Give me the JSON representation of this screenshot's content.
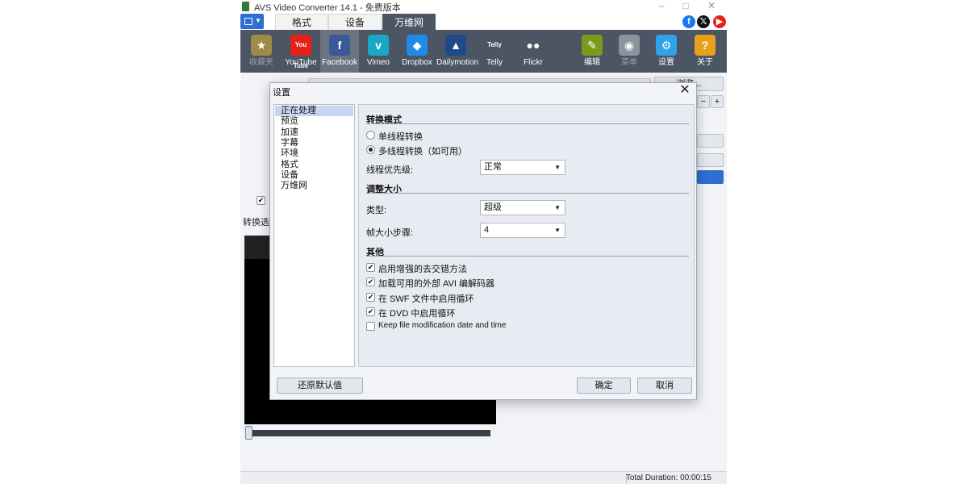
{
  "window": {
    "title": "AVS Video Converter 14.1 - 免费版本",
    "controls": [
      "–",
      "□",
      "✕"
    ]
  },
  "tabs": [
    "格式",
    "设备",
    "万维网"
  ],
  "active_tab": "万维网",
  "social": [
    {
      "icon": "facebook-icon",
      "glyph": "f",
      "color": "#1877f2"
    },
    {
      "icon": "x-icon",
      "glyph": "𝕏",
      "color": "#111111"
    },
    {
      "icon": "youtube-icon",
      "glyph": "▶",
      "color": "#e62117"
    }
  ],
  "toolbar": {
    "items": [
      {
        "label": "收藏夹",
        "icon": "star-icon",
        "glyph": "★",
        "color": "#a08a46",
        "dim": true
      },
      {
        "label": "YouTube",
        "icon": "youtube-icon",
        "glyph": "You Tube",
        "color": "#e62117"
      },
      {
        "label": "Facebook",
        "icon": "facebook-icon",
        "glyph": "f",
        "color": "#3b5998",
        "active": true
      },
      {
        "label": "Vimeo",
        "icon": "vimeo-icon",
        "glyph": "v",
        "color": "#17a8c5"
      },
      {
        "label": "Dropbox",
        "icon": "dropbox-icon",
        "glyph": "◆",
        "color": "#1f8ae8"
      },
      {
        "label": "Dailymotion",
        "icon": "dailymotion-icon",
        "glyph": "▲",
        "color": "#1f4a8a"
      },
      {
        "label": "Telly",
        "icon": "telly-icon",
        "glyph": "Telly",
        "color": "#4b5563"
      },
      {
        "label": "Flickr",
        "icon": "flickr-icon",
        "glyph": "●●",
        "color": "#4b5563"
      },
      {
        "label": "编辑",
        "icon": "pencil-icon",
        "glyph": "✎",
        "color": "#7a9a1d"
      },
      {
        "label": "菜单",
        "icon": "disc-icon",
        "glyph": "◉",
        "color": "#8b939d",
        "dim": true
      },
      {
        "label": "设置",
        "icon": "gear-icon",
        "glyph": "⚙",
        "color": "#2ea3e8"
      },
      {
        "label": "关于",
        "icon": "help-icon",
        "glyph": "?",
        "color": "#e8a11d"
      }
    ]
  },
  "background": {
    "browse_label": "浏览...",
    "checkbox_checked": "✔",
    "conversion_options_label": "转换选",
    "status": {
      "total_duration": "Total Duration: 00:00:15"
    }
  },
  "dialog": {
    "title": "设置",
    "nav": [
      "正在处理",
      "预览",
      "加速",
      "字幕",
      "环境",
      "格式",
      "设备",
      "万维网"
    ],
    "active_nav": "正在处理",
    "conversion_mode": {
      "heading": "转换模式",
      "single_thread": "单线程转换",
      "multi_thread": "多线程转换（如可用）",
      "selected": "multi_thread",
      "priority_label": "线程优先级:",
      "priority_value": "正常"
    },
    "resize": {
      "heading": "调整大小",
      "type_label": "类型:",
      "type_value": "超级",
      "step_label": "帧大小步骤:",
      "step_value": "4"
    },
    "other": {
      "heading": "其他",
      "options": [
        {
          "label": "启用增强的去交错方法",
          "checked": true
        },
        {
          "label": "加载可用的外部 AVI 编解码器",
          "checked": true
        },
        {
          "label": "在 SWF 文件中启用循环",
          "checked": true
        },
        {
          "label": "在 DVD 中启用循环",
          "checked": true
        },
        {
          "label": "Keep file modification date and time",
          "checked": false
        }
      ]
    },
    "buttons": {
      "restore": "还原默认值",
      "ok": "确定",
      "cancel": "取消"
    }
  }
}
